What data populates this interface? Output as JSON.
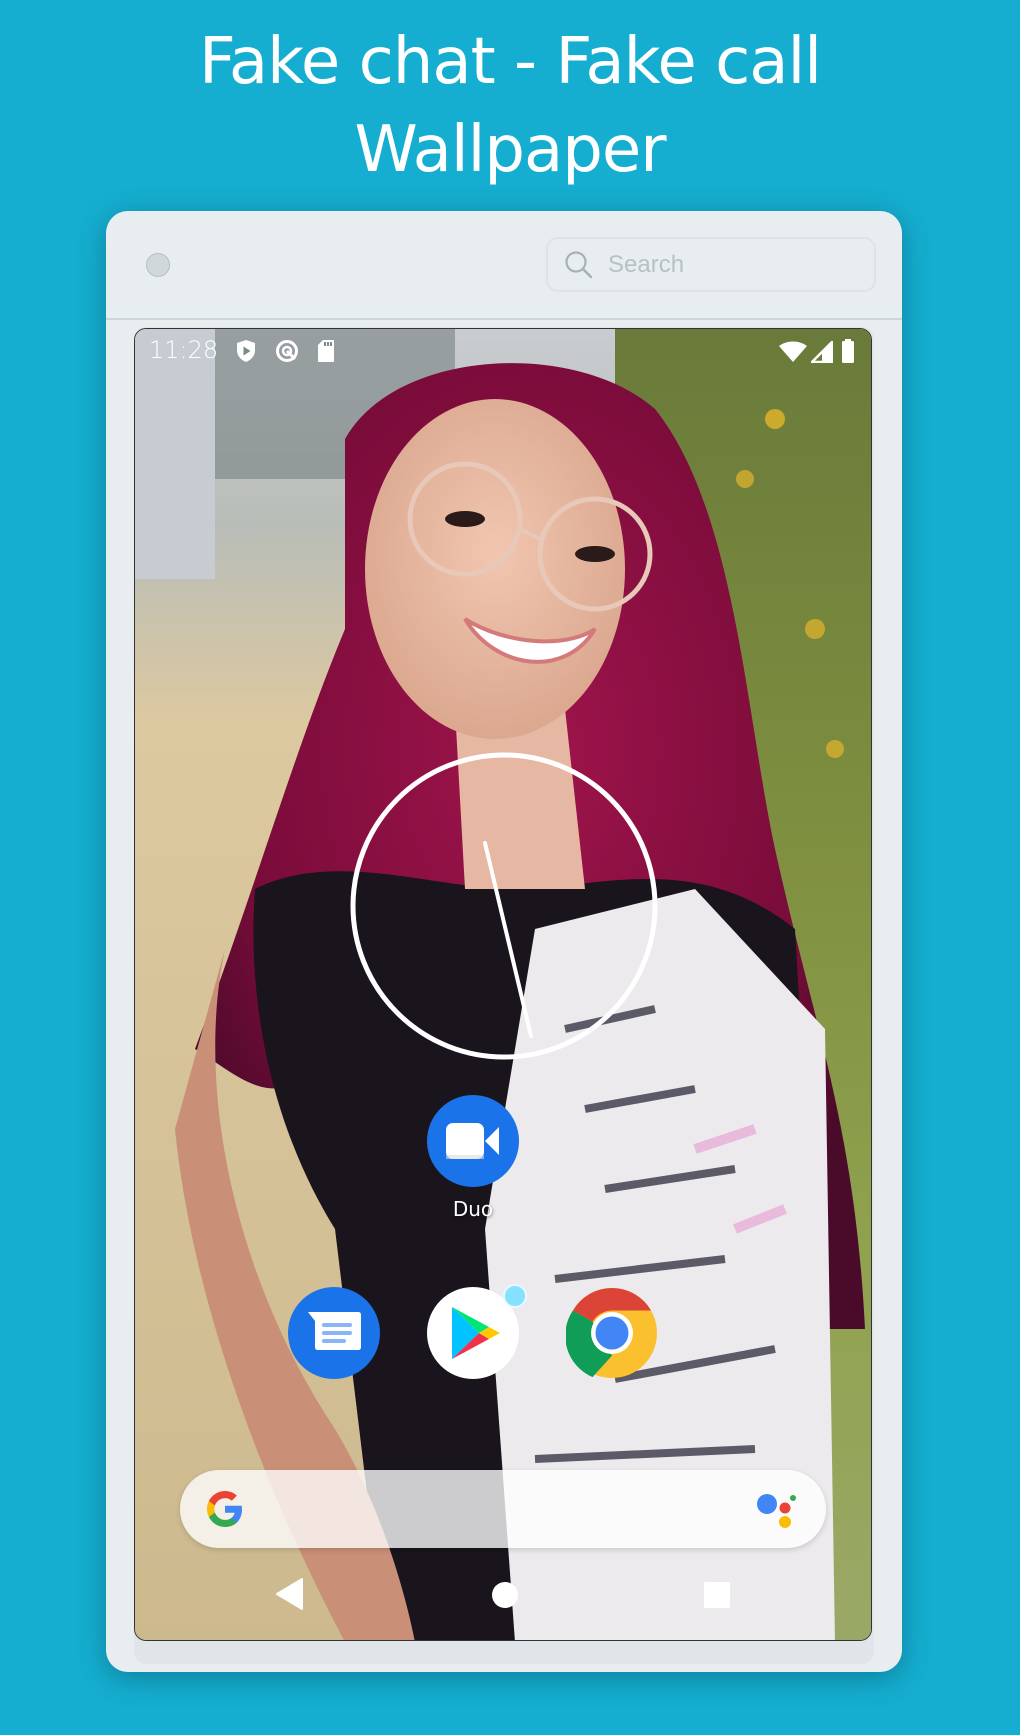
{
  "header": {
    "title_line1": "Fake chat - Fake call",
    "title_line2": "Wallpaper"
  },
  "window": {
    "search_placeholder": "Search",
    "search_value": ""
  },
  "device": {
    "status_bar": {
      "time": "11:28",
      "left_icons": [
        "play-protect-icon",
        "data-saver-icon",
        "sd-card-icon"
      ],
      "right_icons": [
        "wifi-icon",
        "cellular-signal-icon",
        "battery-icon"
      ]
    },
    "wallpaper": {
      "description": "Photo of smiling girl with magenta hair and glasses"
    },
    "clock_widget": {
      "type": "analog",
      "time": "11:28"
    },
    "apps": [
      {
        "name": "Duo",
        "label": "Duo",
        "icon": "duo-video-icon",
        "color": "#1a73e8"
      },
      {
        "name": "Messages",
        "label": "",
        "icon": "messages-icon",
        "color": "#1a73e8"
      },
      {
        "name": "Play Store",
        "label": "",
        "icon": "play-store-icon",
        "color": "#ffffff",
        "badge": true
      },
      {
        "name": "Chrome",
        "label": "",
        "icon": "chrome-icon",
        "color": "#ffffff"
      }
    ],
    "google_bar": {
      "logo": "google-g-icon",
      "assistant": "google-assistant-icon"
    },
    "nav_bar": [
      "back",
      "home",
      "recents"
    ]
  },
  "colors": {
    "background": "#15aed0",
    "frame": "#e8eef0",
    "google_blue": "#4285f4",
    "google_red": "#ea4335",
    "google_yellow": "#fbbc04",
    "google_green": "#34a853"
  }
}
